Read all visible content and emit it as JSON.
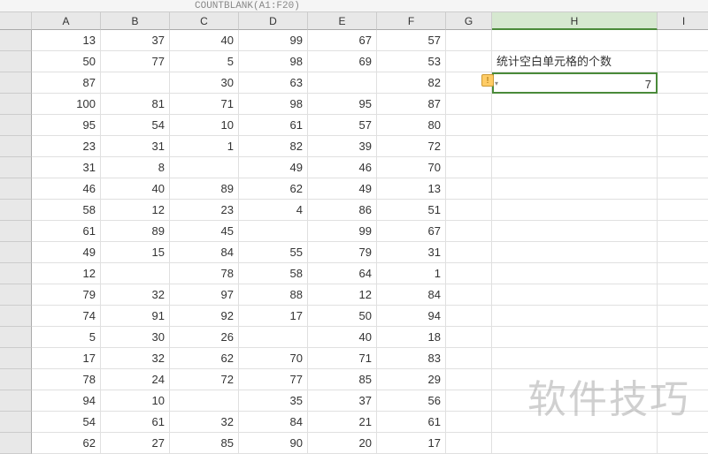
{
  "formula_bar": "COUNTBLANK(A1:F20)",
  "columns": [
    "A",
    "B",
    "C",
    "D",
    "E",
    "F",
    "G",
    "H",
    "I"
  ],
  "selected_col": "H",
  "label_cell": "统计空白单元格的个数",
  "active_value": "7",
  "watermark": "软件技巧",
  "rows": [
    {
      "A": "13",
      "B": "37",
      "C": "40",
      "D": "99",
      "E": "67",
      "F": "57"
    },
    {
      "A": "50",
      "B": "77",
      "C": "5",
      "D": "98",
      "E": "69",
      "F": "53"
    },
    {
      "A": "87",
      "B": "",
      "C": "30",
      "D": "63",
      "E": "",
      "F": "82"
    },
    {
      "A": "100",
      "B": "81",
      "C": "71",
      "D": "98",
      "E": "95",
      "F": "87"
    },
    {
      "A": "95",
      "B": "54",
      "C": "10",
      "D": "61",
      "E": "57",
      "F": "80"
    },
    {
      "A": "23",
      "B": "31",
      "C": "1",
      "D": "82",
      "E": "39",
      "F": "72"
    },
    {
      "A": "31",
      "B": "8",
      "C": "",
      "D": "49",
      "E": "46",
      "F": "70"
    },
    {
      "A": "46",
      "B": "40",
      "C": "89",
      "D": "62",
      "E": "49",
      "F": "13"
    },
    {
      "A": "58",
      "B": "12",
      "C": "23",
      "D": "4",
      "E": "86",
      "F": "51"
    },
    {
      "A": "61",
      "B": "89",
      "C": "45",
      "D": "",
      "E": "99",
      "F": "67"
    },
    {
      "A": "49",
      "B": "15",
      "C": "84",
      "D": "55",
      "E": "79",
      "F": "31"
    },
    {
      "A": "12",
      "B": "",
      "C": "78",
      "D": "58",
      "E": "64",
      "F": "1"
    },
    {
      "A": "79",
      "B": "32",
      "C": "97",
      "D": "88",
      "E": "12",
      "F": "84"
    },
    {
      "A": "74",
      "B": "91",
      "C": "92",
      "D": "17",
      "E": "50",
      "F": "94"
    },
    {
      "A": "5",
      "B": "30",
      "C": "26",
      "D": "",
      "E": "40",
      "F": "18"
    },
    {
      "A": "17",
      "B": "32",
      "C": "62",
      "D": "70",
      "E": "71",
      "F": "83"
    },
    {
      "A": "78",
      "B": "24",
      "C": "72",
      "D": "77",
      "E": "85",
      "F": "29"
    },
    {
      "A": "94",
      "B": "10",
      "C": "",
      "D": "35",
      "E": "37",
      "F": "56"
    },
    {
      "A": "54",
      "B": "61",
      "C": "32",
      "D": "84",
      "E": "21",
      "F": "61"
    },
    {
      "A": "62",
      "B": "27",
      "C": "85",
      "D": "90",
      "E": "20",
      "F": "17"
    }
  ],
  "chart_data": {
    "type": "table",
    "title": "统计空白单元格的个数",
    "columns": [
      "A",
      "B",
      "C",
      "D",
      "E",
      "F"
    ],
    "values": [
      [
        13,
        37,
        40,
        99,
        67,
        57
      ],
      [
        50,
        77,
        5,
        98,
        69,
        53
      ],
      [
        87,
        null,
        30,
        63,
        null,
        82
      ],
      [
        100,
        81,
        71,
        98,
        95,
        87
      ],
      [
        95,
        54,
        10,
        61,
        57,
        80
      ],
      [
        23,
        31,
        1,
        82,
        39,
        72
      ],
      [
        31,
        8,
        null,
        49,
        46,
        70
      ],
      [
        46,
        40,
        89,
        62,
        49,
        13
      ],
      [
        58,
        12,
        23,
        4,
        86,
        51
      ],
      [
        61,
        89,
        45,
        null,
        99,
        67
      ],
      [
        49,
        15,
        84,
        55,
        79,
        31
      ],
      [
        12,
        null,
        78,
        58,
        64,
        1
      ],
      [
        79,
        32,
        97,
        88,
        12,
        84
      ],
      [
        74,
        91,
        92,
        17,
        50,
        94
      ],
      [
        5,
        30,
        26,
        null,
        40,
        18
      ],
      [
        17,
        32,
        62,
        70,
        71,
        83
      ],
      [
        78,
        24,
        72,
        77,
        85,
        29
      ],
      [
        94,
        10,
        null,
        35,
        37,
        56
      ],
      [
        54,
        61,
        32,
        84,
        21,
        61
      ],
      [
        62,
        27,
        85,
        90,
        20,
        17
      ]
    ],
    "result_label": "统计空白单元格的个数",
    "result_formula": "COUNTBLANK(A1:F20)",
    "result_value": 7
  }
}
